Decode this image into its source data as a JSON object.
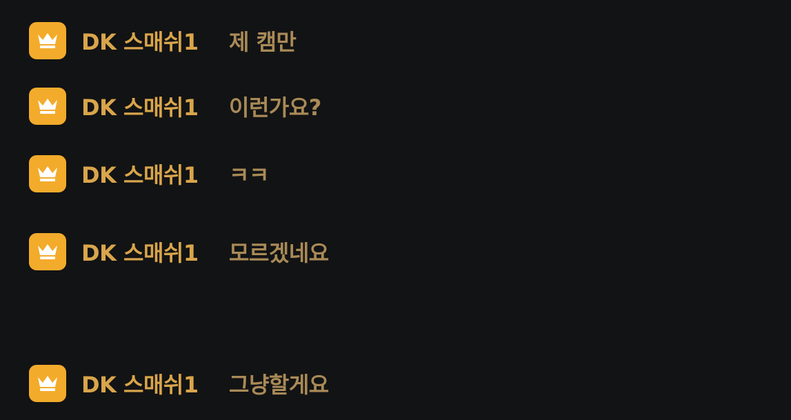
{
  "messages": [
    {
      "username": "DK 스매쉬1",
      "text": "제 캠만",
      "badge_icon": "crown-icon"
    },
    {
      "username": "DK 스매쉬1",
      "text": "이런가요?",
      "badge_icon": "crown-icon"
    },
    {
      "username": "DK 스매쉬1",
      "text": "ㅋㅋ",
      "badge_icon": "crown-icon"
    },
    {
      "username": "DK 스매쉬1",
      "text": "모르겠네요",
      "badge_icon": "crown-icon"
    },
    {
      "username": "DK 스매쉬1",
      "text": "그냥할게요",
      "badge_icon": "crown-icon"
    }
  ],
  "colors": {
    "background": "#121314",
    "badge": "#f3ab2b",
    "username": "#d9a54b",
    "message": "#a98a57"
  }
}
